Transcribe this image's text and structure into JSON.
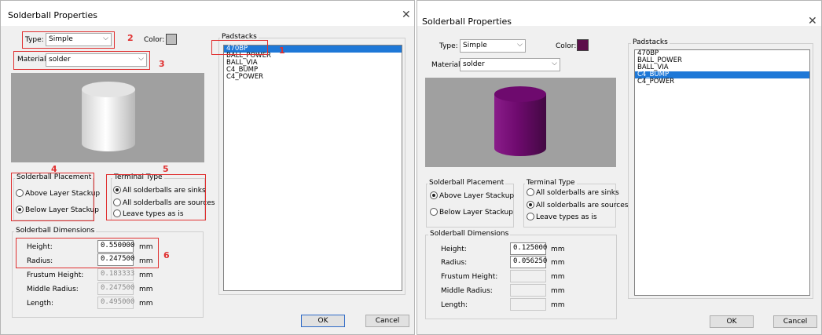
{
  "left": {
    "title": "Solderball Properties",
    "type_label": "Type:",
    "type_value": "Simple",
    "color_label": "Color:",
    "color_hex": "#bdbdbd",
    "material_label": "Material:",
    "material_value": "solder",
    "cylinder_color": "#e4e4e4",
    "placement": {
      "title": "Solderball Placement",
      "options": [
        {
          "label": "Above Layer Stackup",
          "checked": false
        },
        {
          "label": "Below Layer Stackup",
          "checked": true
        }
      ]
    },
    "terminal": {
      "title": "Terminal Type",
      "options": [
        {
          "label": "All solderballs are sinks",
          "checked": true
        },
        {
          "label": "All solderballs are sources",
          "checked": false
        },
        {
          "label": "Leave  types as is",
          "checked": false
        }
      ]
    },
    "dimensions": {
      "title": "Solderball Dimensions",
      "rows": [
        {
          "label": "Height:",
          "value": "0.550000",
          "unit": "mm",
          "enabled": true
        },
        {
          "label": "Radius:",
          "value": "0.247500",
          "unit": "mm",
          "enabled": true
        },
        {
          "label": "Frustum Height:",
          "value": "0.183333",
          "unit": "mm",
          "enabled": false
        },
        {
          "label": "Middle Radius:",
          "value": "0.247500",
          "unit": "mm",
          "enabled": false
        },
        {
          "label": "Length:",
          "value": "0.495000",
          "unit": "mm",
          "enabled": false
        }
      ]
    },
    "padstacks": {
      "title": "Padstacks",
      "items": [
        "470BP",
        "BALL_POWER",
        "BALL_VIA",
        "C4_BUMP",
        "C4_POWER"
      ],
      "selected": 0
    },
    "ok_label": "OK",
    "cancel_label": "Cancel",
    "annotations": [
      "1",
      "2",
      "3",
      "4",
      "5",
      "6"
    ],
    "annotation_color": "#e03030"
  },
  "right": {
    "title": "Solderball Properties",
    "type_label": "Type:",
    "type_value": "Simple",
    "color_label": "Color:",
    "color_hex": "#5c0f4a",
    "material_label": "Material:",
    "material_value": "solder",
    "cylinder_color": "#6e0a6e",
    "placement": {
      "title": "Solderball Placement",
      "options": [
        {
          "label": "Above Layer Stackup",
          "checked": true
        },
        {
          "label": "Below Layer Stackup",
          "checked": false
        }
      ]
    },
    "terminal": {
      "title": "Terminal Type",
      "options": [
        {
          "label": "All solderballs are sinks",
          "checked": false
        },
        {
          "label": "All solderballs are sources",
          "checked": true
        },
        {
          "label": "Leave  types as is",
          "checked": false
        }
      ]
    },
    "dimensions": {
      "title": "Solderball Dimensions",
      "rows": [
        {
          "label": "Height:",
          "value": "0.125000",
          "unit": "mm",
          "enabled": true
        },
        {
          "label": "Radius:",
          "value": "0.056250",
          "unit": "mm",
          "enabled": true
        },
        {
          "label": "Frustum Height:",
          "value": "",
          "unit": "mm",
          "enabled": false
        },
        {
          "label": "Middle Radius:",
          "value": "",
          "unit": "mm",
          "enabled": false
        },
        {
          "label": "Length:",
          "value": "",
          "unit": "mm",
          "enabled": false
        }
      ]
    },
    "padstacks": {
      "title": "Padstacks",
      "items": [
        "470BP",
        "BALL_POWER",
        "BALL_VIA",
        "C4_BUMP",
        "C4_POWER"
      ],
      "selected": 3
    },
    "ok_label": "OK",
    "cancel_label": "Cancel"
  }
}
